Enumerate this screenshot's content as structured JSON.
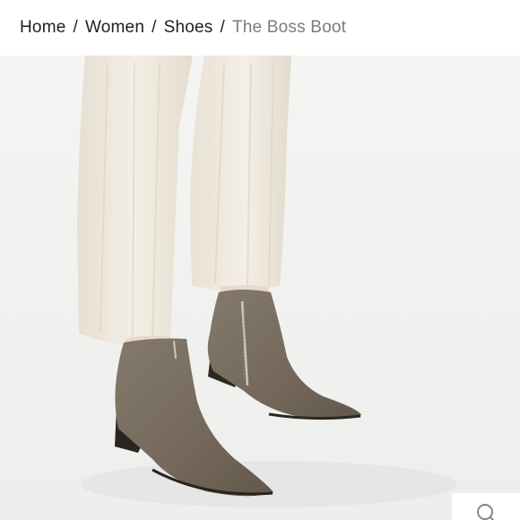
{
  "breadcrumb": {
    "items": [
      {
        "label": "Home"
      },
      {
        "label": "Women"
      },
      {
        "label": "Shoes"
      }
    ],
    "separator": "/",
    "current": "The Boss Boot"
  },
  "product_image": {
    "subject": "pointed-toe ankle boots in taupe leather with side zipper, worn under cream corduroy trousers",
    "colors": {
      "background": "#f3f3f2",
      "trousers": "#efe9dd",
      "leather": "#786d5f",
      "heel": "#3a302b"
    }
  },
  "zoom": {
    "icon": "zoom-icon"
  }
}
